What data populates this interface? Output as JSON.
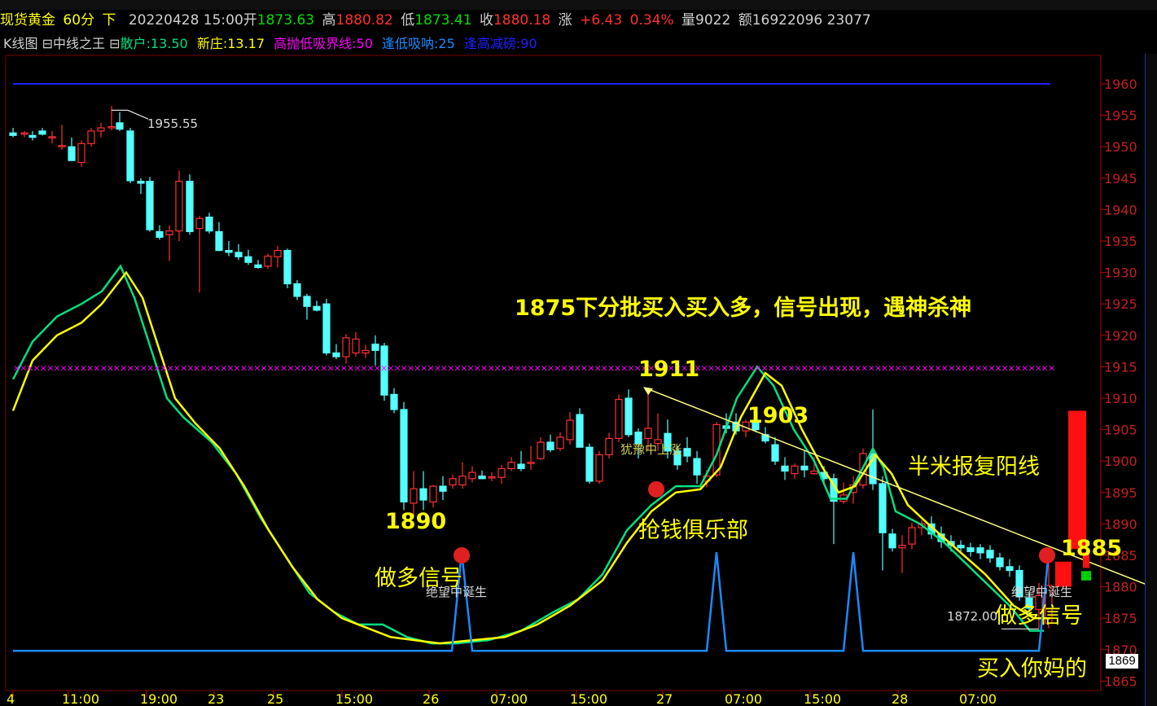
{
  "header": {
    "symbol": "现货黄金",
    "period": "60分",
    "direction": "下",
    "datetime": "20220428 15:00",
    "open_label": "开",
    "open_value": "1873.63",
    "high_label": "高",
    "high_value": "1880.82",
    "low_label": "低",
    "low_value": "1873.41",
    "close_label": "收",
    "close_value": "1880.18",
    "change_label": "涨",
    "change_value": "+6.43",
    "change_pct": "0.34%",
    "volume_label": "量",
    "volume_value": "9022",
    "amount_label": "额",
    "amount_value": "16922096 23077"
  },
  "indicator_bar": {
    "chart_name": "K线图",
    "formula_name": "中线之王",
    "retail_label": "散户:",
    "retail_value": "13.50",
    "dealer_label": "新庄:",
    "dealer_value": "13.17",
    "boundary_label": "高抛低吸界线:",
    "boundary_value": "50",
    "low_absorb_label": "逢低吸呐:",
    "low_absorb_value": "25",
    "high_reduce_label": "逢高减磅:",
    "high_reduce_value": "90"
  },
  "annotations": {
    "headline": "1875下分批买入买入多，信号出现，遇神杀神",
    "p1911": "1911",
    "p1903": "1903",
    "p1890": "1890",
    "p1885": "1885",
    "half_rice": "半米报复阳线",
    "grab_money": "抢钱俱乐部",
    "long_signal_1": "做多信号",
    "long_signal_2": "做多信号",
    "buy_text": "买入你妈的",
    "despair_1": "绝望中诞生",
    "despair_2": "绝望中诞生",
    "hesitate": "犹豫中上涨",
    "high_mark": "1955.55",
    "low_mark": "1872.00",
    "current_price_tag": "1869"
  },
  "colors": {
    "up": "#ff3030",
    "down": "#54ffff",
    "green_line": "#00e080",
    "yellow_line": "#ffff00",
    "blue_line": "#1a8aff",
    "dark_blue_line": "#2020ff",
    "magenta": "#ff00ff",
    "axis_red": "#c00000"
  },
  "chart_data": {
    "type": "candlestick",
    "y_axis_ticks": [
      "1960",
      "1955",
      "1950",
      "1945",
      "1940",
      "1935",
      "1930",
      "1925",
      "1920",
      "1915",
      "1910",
      "1905",
      "1900",
      "1895",
      "1890",
      "1885",
      "1880",
      "1875",
      "1870",
      "1865"
    ],
    "x_axis_ticks": [
      "4",
      "11:00",
      "19:00",
      "23",
      "25",
      "15:00",
      "26",
      "07:00",
      "15:00",
      "27",
      "07:00",
      "15:00",
      "28",
      "07:00"
    ],
    "ylim": [
      1865,
      1962
    ],
    "reference_lines": {
      "top_blue": 1960,
      "magenta_x": 1915
    }
  }
}
